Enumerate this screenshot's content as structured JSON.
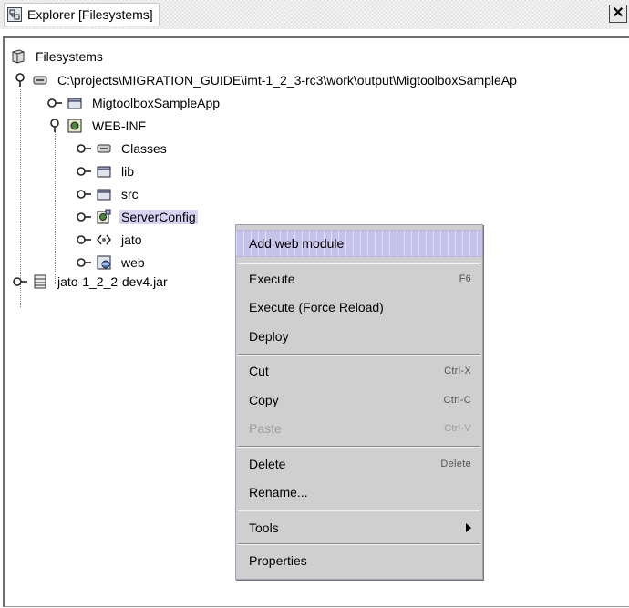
{
  "window": {
    "title": "Explorer [Filesystems]",
    "close_label": "✕"
  },
  "tree": {
    "root_label": "Filesystems",
    "mount_label": "C:\\projects\\MIGRATION_GUIDE\\imt-1_2_3-rc3\\work\\output\\MigtoolboxSampleAp",
    "app_label": "MigtoolboxSampleApp",
    "webinf_label": "WEB-INF",
    "classes_label": "Classes",
    "lib_label": "lib",
    "src_label": "src",
    "serverconfig_label": "ServerConfig",
    "jato_label": "jato",
    "web_label": "web",
    "jar_label": "jato-1_2_2-dev4.jar"
  },
  "menu": {
    "add_web_module": "Add web module",
    "execute": "Execute",
    "execute_shortcut": "F6",
    "execute_force": "Execute (Force Reload)",
    "deploy": "Deploy",
    "cut": "Cut",
    "cut_shortcut": "Ctrl-X",
    "copy": "Copy",
    "copy_shortcut": "Ctrl-C",
    "paste": "Paste",
    "paste_shortcut": "Ctrl-V",
    "delete": "Delete",
    "delete_shortcut": "Delete",
    "rename": "Rename...",
    "tools": "Tools",
    "properties": "Properties"
  },
  "colors": {
    "selection": "#d7d3f3",
    "menu_bg": "#cfcfcf",
    "menu_highlight": "#c6c2ea",
    "disabled_text": "#9c9c9c"
  }
}
